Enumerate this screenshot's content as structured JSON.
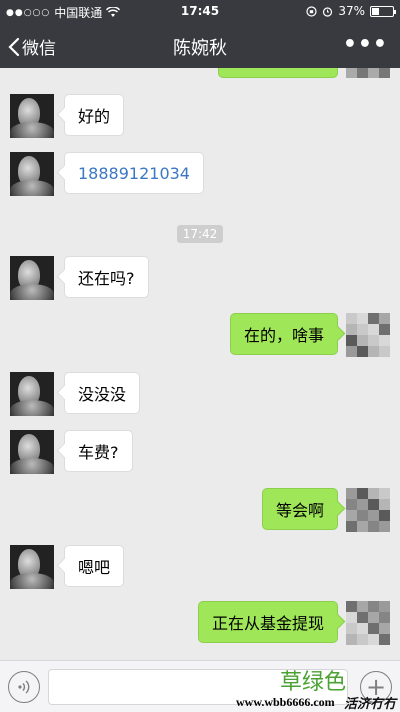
{
  "status_bar": {
    "signal_dots": "●●○○○",
    "carrier": "中国联通",
    "time": "17:45",
    "battery_percent_label": "37%",
    "battery_level": 0.37
  },
  "nav": {
    "back_label": "微信",
    "title": "陈婉秋",
    "more_icon": "more-dots-icon"
  },
  "messages": [
    {
      "side": "in",
      "text": "好的"
    },
    {
      "side": "in",
      "text": "18889121034",
      "is_link": true
    },
    {
      "side": "in",
      "text": "还在吗?"
    },
    {
      "side": "out",
      "text": "在的，啥事"
    },
    {
      "side": "in",
      "text": "没没没"
    },
    {
      "side": "in",
      "text": "车费?"
    },
    {
      "side": "out",
      "text": "等会啊"
    },
    {
      "side": "in",
      "text": "嗯吧"
    },
    {
      "side": "out",
      "text": "正在从基金提现"
    }
  ],
  "timestamp": "17:42",
  "input_bar": {
    "voice_icon": "voice-icon",
    "plus_icon": "plus-icon"
  },
  "watermark": {
    "label": "草绿色",
    "url": "www.wbb6666.com",
    "logo": "活济冇冇守"
  },
  "colors": {
    "nav_bg": "#393a3f",
    "chat_bg": "#ebebeb",
    "bubble_out": "#9fe658",
    "bubble_in": "#ffffff",
    "link": "#3b77c4"
  }
}
